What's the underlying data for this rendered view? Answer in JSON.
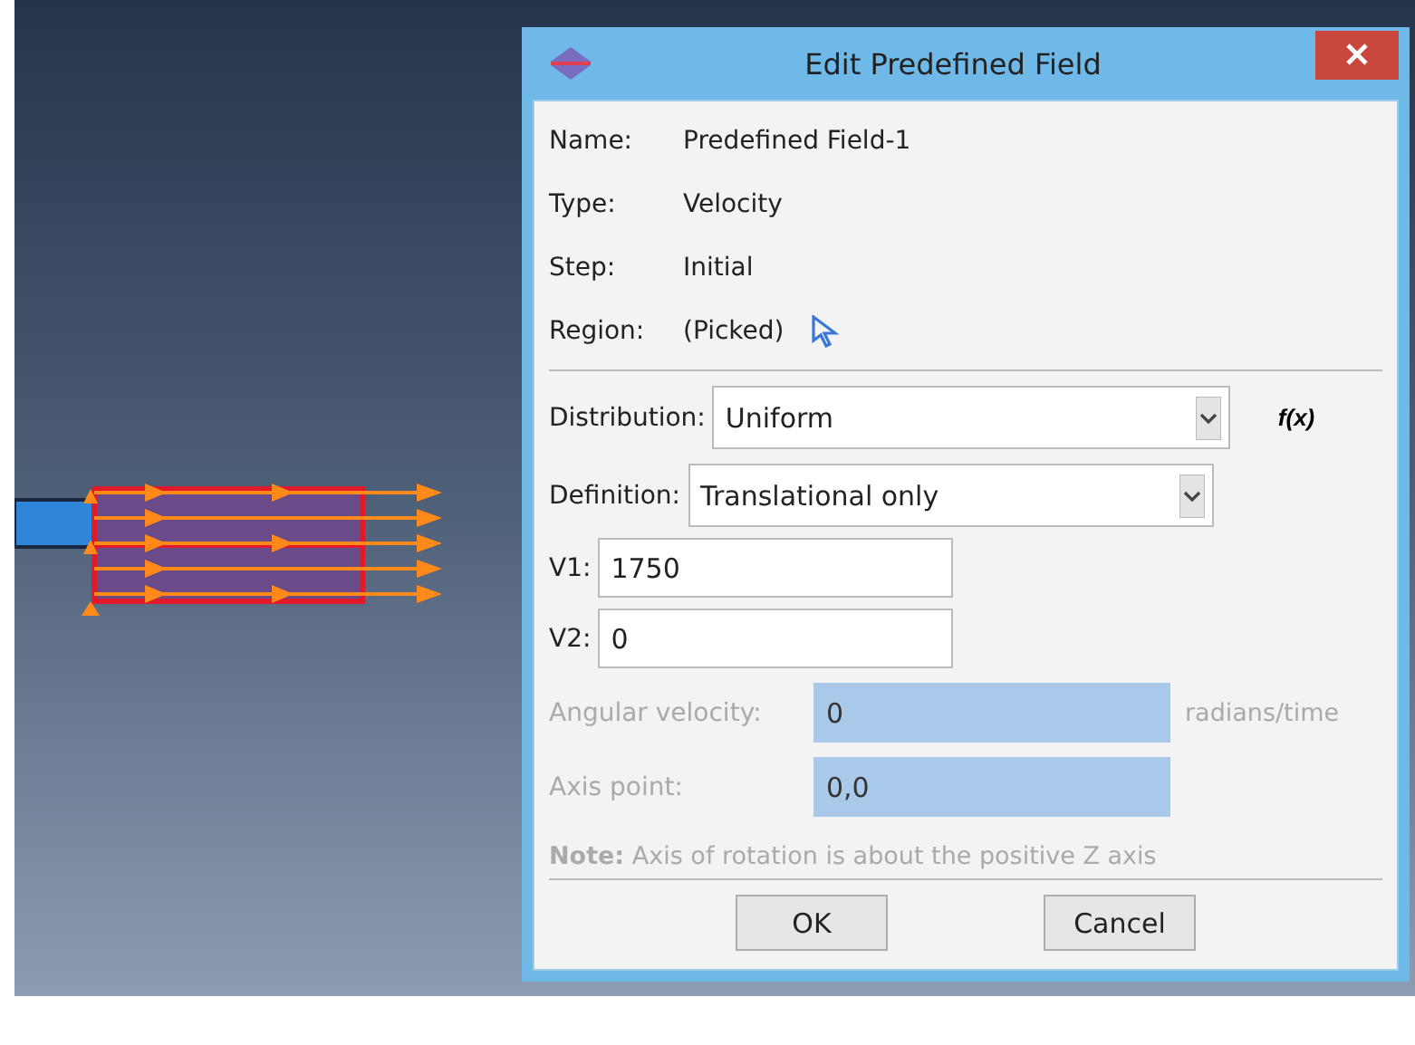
{
  "window": {
    "title": "Edit Predefined Field"
  },
  "info": [
    {
      "label": "Name:",
      "value": "Predefined Field-1",
      "kind": "text"
    },
    {
      "label": "Type:",
      "value": "Velocity",
      "kind": "text"
    },
    {
      "label": "Step:",
      "value": "Initial",
      "kind": "text"
    },
    {
      "label": "Region:",
      "value": "(Picked)",
      "kind": "pick"
    }
  ],
  "distribution": {
    "label": "Distribution:",
    "value": "Uniform",
    "function_button": "f(x)"
  },
  "definition": {
    "label": "Definition:",
    "value": "Translational only"
  },
  "velocities": [
    {
      "label": "V1:",
      "value": "1750"
    },
    {
      "label": "V2:",
      "value": "0"
    }
  ],
  "angular_velocity": {
    "label": "Angular velocity:",
    "value": "0",
    "unit": "radians/time",
    "disabled": true
  },
  "axis_point": {
    "label": "Axis point:",
    "value": "0,0",
    "disabled": true
  },
  "note": {
    "text": "**Note:**  Axis of rotation is about the positive Z axis",
    "disabled": true
  },
  "buttons": [
    "OK",
    "Cancel"
  ]
}
